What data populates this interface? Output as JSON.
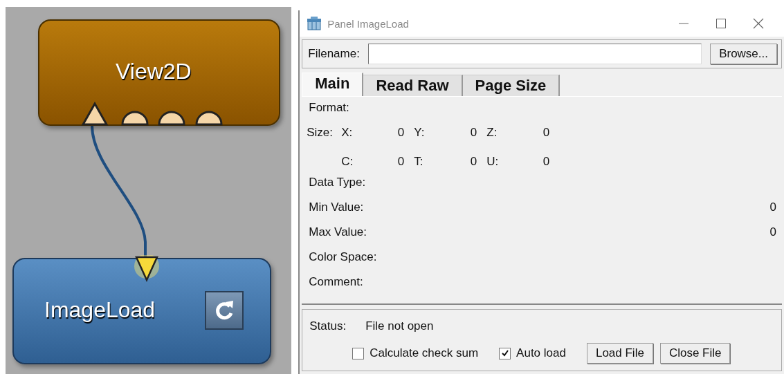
{
  "network": {
    "nodes": [
      {
        "kind": "viewer",
        "label": "View2D"
      },
      {
        "kind": "module",
        "label": "ImageLoad"
      }
    ]
  },
  "window": {
    "title": "Panel ImageLoad"
  },
  "filename": {
    "label": "Filename:",
    "button": "Browse..."
  },
  "tabs": [
    {
      "label": "Main",
      "selected": true
    },
    {
      "label": "Read Raw",
      "selected": false
    },
    {
      "label": "Page Size",
      "selected": false
    }
  ],
  "format": {
    "label": "Format:"
  },
  "size": {
    "label": "Size:",
    "rows": [
      [
        {
          "label": "X:",
          "value": "0"
        },
        {
          "label": "Y:",
          "value": "0"
        },
        {
          "label": "Z:",
          "value": "0"
        }
      ],
      [
        {
          "label": "C:",
          "value": "0"
        },
        {
          "label": "T:",
          "value": "0"
        },
        {
          "label": "U:",
          "value": "0"
        }
      ]
    ]
  },
  "fields": [
    {
      "label": "Data Type:"
    },
    {
      "label": "Min Value:",
      "value": "0"
    },
    {
      "label": "Max Value:",
      "value": "0"
    },
    {
      "label": "Color Space:"
    },
    {
      "label": "Comment:"
    }
  ],
  "status": {
    "label": "Status:",
    "value": "File not open"
  },
  "options": [
    {
      "label": "Calculate check sum",
      "checked": false
    },
    {
      "label": "Auto load",
      "checked": true
    }
  ],
  "buttons": [
    "Load File",
    "Close File"
  ]
}
